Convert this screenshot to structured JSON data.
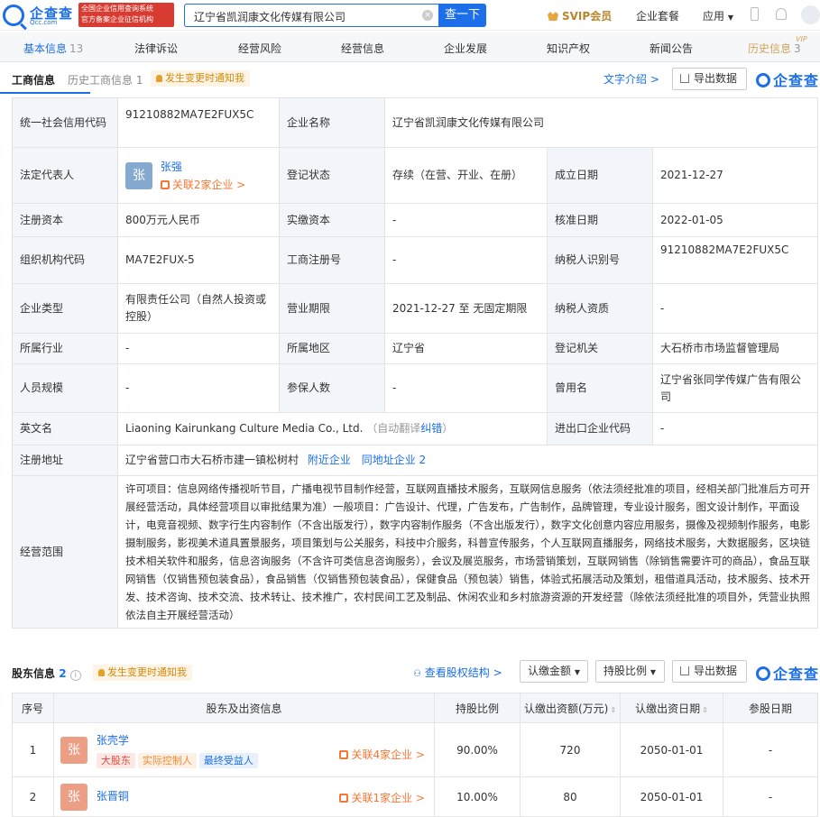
{
  "brand": {
    "name": "企查查",
    "domain": "Qcc.com",
    "tag_line1": "全国企业信用查询系统",
    "tag_line2": "官方备案企业征信机构",
    "color": "#1c6fe8"
  },
  "search": {
    "value": "辽宁省凯润康文化传媒有限公司",
    "button": "查一下",
    "clear_icon": "close-icon"
  },
  "topnav": {
    "svip": "SVIP会员",
    "package": "企业套餐",
    "apps": "应用"
  },
  "tabs": [
    {
      "label": "基本信息",
      "count": "13"
    },
    {
      "label": "法律诉讼",
      "count": ""
    },
    {
      "label": "经营风险",
      "count": ""
    },
    {
      "label": "经营信息",
      "count": ""
    },
    {
      "label": "企业发展",
      "count": ""
    },
    {
      "label": "知识产权",
      "count": ""
    },
    {
      "label": "新闻公告",
      "count": ""
    },
    {
      "label": "历史信息",
      "count": "3",
      "sup": "VIP"
    }
  ],
  "biz": {
    "title": "工商信息",
    "history": "历史工商信息",
    "history_count": "1",
    "notify": "发生变更时通知我",
    "intro": "文字介绍 >",
    "export": "导出数据",
    "brand": "企查查"
  },
  "info": {
    "credit_code_k": "统一社会信用代码",
    "credit_code_v": "91210882MA7E2FUX5C",
    "name_k": "企业名称",
    "name_v": "辽宁省凯润康文化传媒有限公司",
    "legal_k": "法定代表人",
    "legal_avatar": "张",
    "legal_name": "张强",
    "legal_rel": "关联2家企业 >",
    "status_k": "登记状态",
    "status_v": "存续（在营、开业、在册）",
    "est_k": "成立日期",
    "est_v": "2021-12-27",
    "capital_k": "注册资本",
    "capital_v": "800万元人民币",
    "paid_k": "实缴资本",
    "paid_v": "-",
    "approve_k": "核准日期",
    "approve_v": "2022-01-05",
    "org_k": "组织机构代码",
    "org_v": "MA7E2FUX-5",
    "reg_k": "工商注册号",
    "reg_v": "-",
    "tax_k": "纳税人识别号",
    "tax_v": "91210882MA7E2FUX5C",
    "type_k": "企业类型",
    "type_v": "有限责任公司（自然人投资或控股）",
    "term_k": "营业期限",
    "term_v": "2021-12-27 至 无固定期限",
    "taxq_k": "纳税人资质",
    "taxq_v": "-",
    "industry_k": "所属行业",
    "industry_v": "-",
    "region_k": "所属地区",
    "region_v": "辽宁省",
    "authority_k": "登记机关",
    "authority_v": "大石桥市市场监督管理局",
    "staff_k": "人员规模",
    "staff_v": "-",
    "insured_k": "参保人数",
    "insured_v": "-",
    "former_k": "曾用名",
    "former_v": "辽宁省张同学传媒广告有限公司",
    "en_k": "英文名",
    "en_v": "Liaoning Kairunkang Culture Media Co., Ltd.",
    "en_auto": "（自动翻译",
    "en_fix": "纠错",
    "en_close": "）",
    "ie_k": "进出口企业代码",
    "ie_v": "-",
    "addr_k": "注册地址",
    "addr_v": "辽宁省营口市大石桥市建一镇松树村",
    "addr_near": "附近企业",
    "addr_same": "同地址企业 2",
    "scope_k": "经营范围",
    "scope_v": "许可项目：信息网络传播视听节目，广播电视节目制作经营，互联网直播技术服务，互联网信息服务（依法须经批准的项目，经相关部门批准后方可开展经营活动，具体经营项目以审批结果为准）一般项目：广告设计、代理，广告发布，广告制作，品牌管理，专业设计服务，图文设计制作，平面设计，电竞音视频、数字行生内容制作（不含出版发行），数字内容制作服务（不含出版发行），数字文化创意内容应用服务，摄像及视频制作服务，电影摄制服务，影视美术道具置景服务，项目策划与公关服务，科技中介服务，科普宣传服务，个人互联网直播服务，网络技术服务，大数据服务，区块链技术相关软件和服务，信息咨询服务（不含许可类信息咨询服务），会议及展览服务，市场营销策划，互联网销售（除销售需要许可的商品），食品互联网销售（仅销售预包装食品），食品销售（仅销售预包装食品），保健食品（预包装）销售，体验式拓展活动及策划，租借道具活动，技术服务、技术开发、技术咨询、技术交流、技术转让、技术推广，农村民间工艺及制品、休闲农业和乡村旅游资源的开发经营（除依法须经批准的项目外，凭营业执照依法自主开展经营活动）"
  },
  "shareholders": {
    "title": "股东信息",
    "count": "2",
    "notify": "发生变更时通知我",
    "structure": "查看股权结构 >",
    "amount_btn": "认缴金额",
    "ratio_btn": "持股比例",
    "export": "导出数据",
    "brand": "企查查",
    "headers": [
      "序号",
      "股东及出资信息",
      "持股比例",
      "认缴出资额(万元)",
      "认缴出资日期",
      "参股日期"
    ],
    "rows": [
      {
        "no": "1",
        "avatar": "张",
        "name": "张壳学",
        "tags": [
          "大股东",
          "实际控制人",
          "最终受益人"
        ],
        "rel": "关联4家企业 >",
        "ratio": "90.00%",
        "amount": "720",
        "date": "2050-01-01",
        "join": "-"
      },
      {
        "no": "2",
        "avatar": "张",
        "name": "张晋铜",
        "tags": [],
        "rel": "关联1家企业 >",
        "ratio": "10.00%",
        "amount": "80",
        "date": "2050-01-01",
        "join": "-"
      }
    ]
  }
}
